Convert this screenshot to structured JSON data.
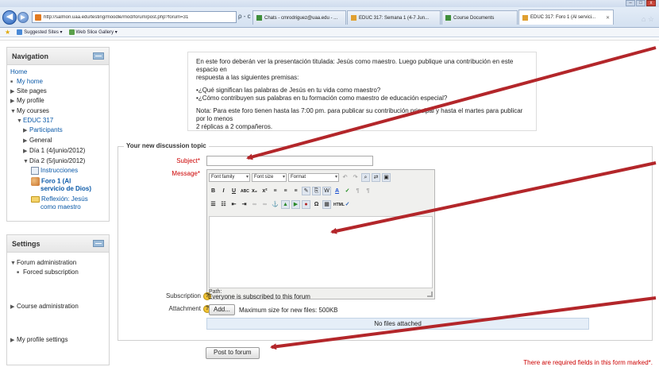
{
  "browser": {
    "url": "http://salmon.uaa.edu/testing/moodle/mod/forum/post.php?forum=31",
    "address_actions": "ρ - c X",
    "tabs": [
      {
        "label": "Chats - cmrodriguez@uaa.edu - ..."
      },
      {
        "label": "EDUC 317: Semana 1 (4-7 Jun..."
      },
      {
        "label": "Course Documents"
      },
      {
        "label": "EDUC 317: Foro 1 (Al servici..."
      }
    ],
    "window_controls": {
      "minimize": "–",
      "maximize": "□",
      "close": "x"
    },
    "favorites": [
      {
        "label": "Suggested Sites ▾"
      },
      {
        "label": "Web Slice Gallery ▾"
      }
    ]
  },
  "navigation": {
    "title": "Navigation",
    "items": [
      {
        "label": "Home"
      },
      {
        "label": "My home"
      },
      {
        "label": "Site pages"
      },
      {
        "label": "My profile"
      },
      {
        "label": "My courses"
      },
      {
        "label": "EDUC 317"
      },
      {
        "label": "Participants"
      },
      {
        "label": "General"
      },
      {
        "label": "Día 1 (4/junio/2012)"
      },
      {
        "label": "Día 2 (5/junio/2012)"
      },
      {
        "label": "Instrucciones"
      },
      {
        "label_line1": "Foro 1 (Al",
        "label_line2": "servicio de Dios)"
      },
      {
        "label_line1": "Reflexión: Jesús",
        "label_line2": "como maestro"
      }
    ]
  },
  "settings": {
    "title": "Settings",
    "items": [
      {
        "label": "Forum administration"
      },
      {
        "label": "Forced subscription"
      },
      {
        "label": "Course administration"
      },
      {
        "label": "My profile settings"
      }
    ]
  },
  "intro": {
    "p1_line1": "En este foro deberán ver la presentación titulada: Jesús como maestro. Luego publique una contribución en este espacio en",
    "p1_line2": "respuesta a las siguientes premisas:",
    "q1": "•¿Qué significan las palabras de Jesús en tu vida como maestro?",
    "q2": "•¿Cómo contribuyen sus palabras en tu formación como maestro de educación especial?",
    "note_line1": "Nota: Para este foro tienen hasta las 7:00 pm. para publicar su contribución principal y hasta el martes para publicar por lo menos",
    "note_line2": "2 réplicas a 2 compañeros."
  },
  "form": {
    "legend": "Your new discussion topic",
    "subject_label": "Subject",
    "subject_value": "",
    "message_label": "Message",
    "required_mark": "*",
    "editor": {
      "font_family": "Font family",
      "font_size": "Font size",
      "format": "Format",
      "path_label": "Path:"
    },
    "subscription_label": "Subscription",
    "subscription_value": "Everyone is subscribed to this forum",
    "attachment_label": "Attachment",
    "add_button": "Add...",
    "max_size": "Maximum size for new files: 500KB",
    "no_files": "No files attached",
    "post_button": "Post to forum",
    "required_note": "There are required fields in this form marked*."
  },
  "colors": {
    "link": "#0a59a8",
    "required": "#cc0000",
    "annotation_arrow": "#b3262a"
  }
}
